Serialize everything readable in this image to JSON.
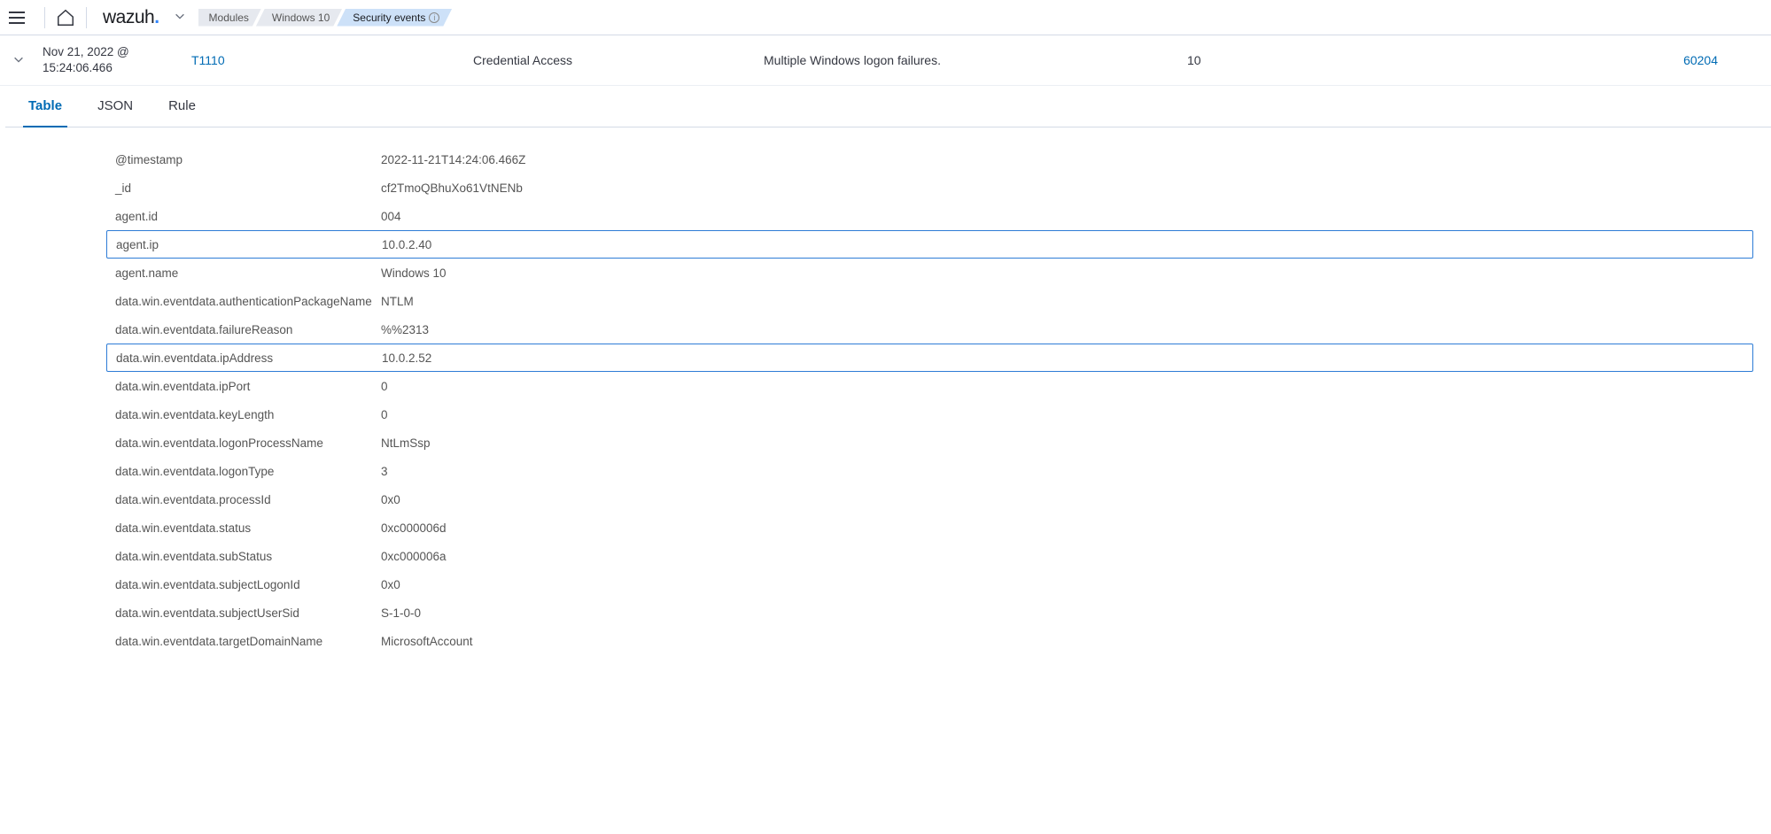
{
  "topbar": {
    "logo_text": "wazuh",
    "logo_dot": ".",
    "breadcrumbs": [
      {
        "label": "Modules",
        "active": false
      },
      {
        "label": "Windows 10",
        "active": false
      },
      {
        "label": "Security events",
        "active": true,
        "has_info": true
      }
    ]
  },
  "event": {
    "timestamp_line1": "Nov 21, 2022 @",
    "timestamp_line2": "15:24:06.466",
    "technique": "T1110",
    "tactic": "Credential Access",
    "description": "Multiple Windows logon failures.",
    "count": "10",
    "rule_id": "60204"
  },
  "tabs": [
    {
      "id": "table",
      "label": "Table",
      "active": true
    },
    {
      "id": "json",
      "label": "JSON",
      "active": false
    },
    {
      "id": "rule",
      "label": "Rule",
      "active": false
    }
  ],
  "details": [
    {
      "key": "@timestamp",
      "value": "2022-11-21T14:24:06.466Z",
      "highlighted": false
    },
    {
      "key": "_id",
      "value": "cf2TmoQBhuXo61VtNENb",
      "highlighted": false
    },
    {
      "key": "agent.id",
      "value": "004",
      "highlighted": false
    },
    {
      "key": "agent.ip",
      "value": "10.0.2.40",
      "highlighted": true
    },
    {
      "key": "agent.name",
      "value": "Windows 10",
      "highlighted": false
    },
    {
      "key": "data.win.eventdata.authenticationPackageName",
      "value": "NTLM",
      "highlighted": false
    },
    {
      "key": "data.win.eventdata.failureReason",
      "value": "%%2313",
      "highlighted": false
    },
    {
      "key": "data.win.eventdata.ipAddress",
      "value": "10.0.2.52",
      "highlighted": true
    },
    {
      "key": "data.win.eventdata.ipPort",
      "value": "0",
      "highlighted": false
    },
    {
      "key": "data.win.eventdata.keyLength",
      "value": "0",
      "highlighted": false
    },
    {
      "key": "data.win.eventdata.logonProcessName",
      "value": "NtLmSsp",
      "highlighted": false
    },
    {
      "key": "data.win.eventdata.logonType",
      "value": "3",
      "highlighted": false
    },
    {
      "key": "data.win.eventdata.processId",
      "value": "0x0",
      "highlighted": false
    },
    {
      "key": "data.win.eventdata.status",
      "value": "0xc000006d",
      "highlighted": false
    },
    {
      "key": "data.win.eventdata.subStatus",
      "value": "0xc000006a",
      "highlighted": false
    },
    {
      "key": "data.win.eventdata.subjectLogonId",
      "value": "0x0",
      "highlighted": false
    },
    {
      "key": "data.win.eventdata.subjectUserSid",
      "value": "S-1-0-0",
      "highlighted": false
    },
    {
      "key": "data.win.eventdata.targetDomainName",
      "value": "MicrosoftAccount",
      "highlighted": false
    }
  ]
}
